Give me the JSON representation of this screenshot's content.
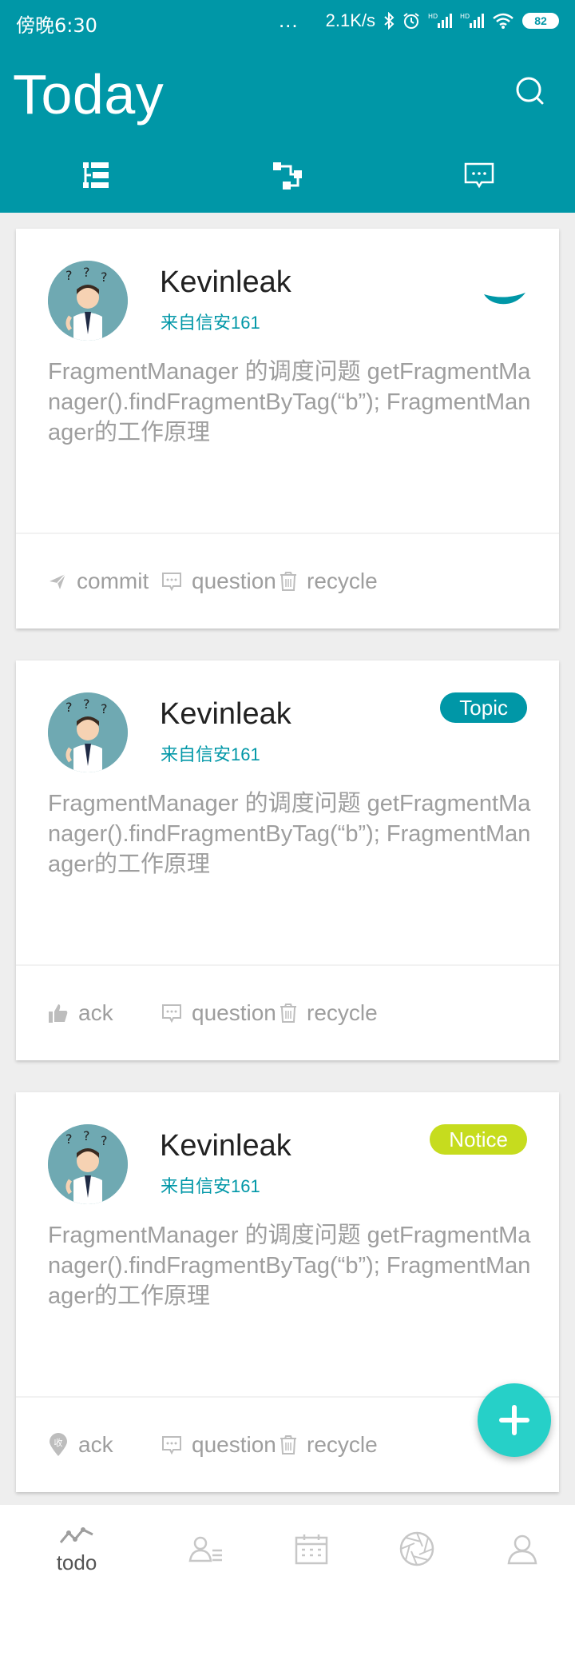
{
  "status_bar": {
    "time": "傍晚6:30",
    "more": "...",
    "speed": "2.1K/s",
    "battery": "82"
  },
  "header": {
    "title": "Today"
  },
  "colors": {
    "primary": "#0097a7",
    "topic_badge": "#0097a7",
    "notice_badge": "#c6dc1e",
    "fab": "#26d0c8",
    "list_background": "#eeeeee"
  },
  "cards": [
    {
      "author": "Kevinleak",
      "source": "来自信安161",
      "content": "FragmentManager 的调度问题 getFragmentManager().findFragmentByTag(“b”); FragmentManager的工作原理",
      "actions": [
        {
          "label": "commit",
          "icon": "send-icon"
        },
        {
          "label": "question",
          "icon": "comment-icon"
        },
        {
          "label": "recycle",
          "icon": "trash-icon"
        }
      ]
    },
    {
      "author": "Kevinleak",
      "source": "来自信安161",
      "badge": "Topic",
      "content": "FragmentManager 的调度问题 getFragmentManager().findFragmentByTag(“b”); FragmentManager的工作原理",
      "actions": [
        {
          "label": "ack",
          "icon": "thumbs-up-icon"
        },
        {
          "label": "question",
          "icon": "comment-icon"
        },
        {
          "label": "recycle",
          "icon": "trash-icon"
        }
      ]
    },
    {
      "author": "Kevinleak",
      "source": "来自信安161",
      "badge": "Notice",
      "content": "FragmentManager 的调度问题 getFragmentManager().findFragmentByTag(“b”); FragmentManager的工作原理",
      "actions": [
        {
          "label": "ack",
          "icon": "location-pin-icon",
          "icon_text": "收"
        },
        {
          "label": "question",
          "icon": "comment-icon"
        },
        {
          "label": "recycle",
          "icon": "trash-icon"
        }
      ]
    }
  ],
  "bottom_nav": [
    {
      "label": "todo",
      "icon": "trend-icon",
      "active": true
    },
    {
      "label": "",
      "icon": "contacts-icon"
    },
    {
      "label": "",
      "icon": "calendar-icon"
    },
    {
      "label": "",
      "icon": "aperture-icon"
    },
    {
      "label": "",
      "icon": "user-icon"
    }
  ]
}
